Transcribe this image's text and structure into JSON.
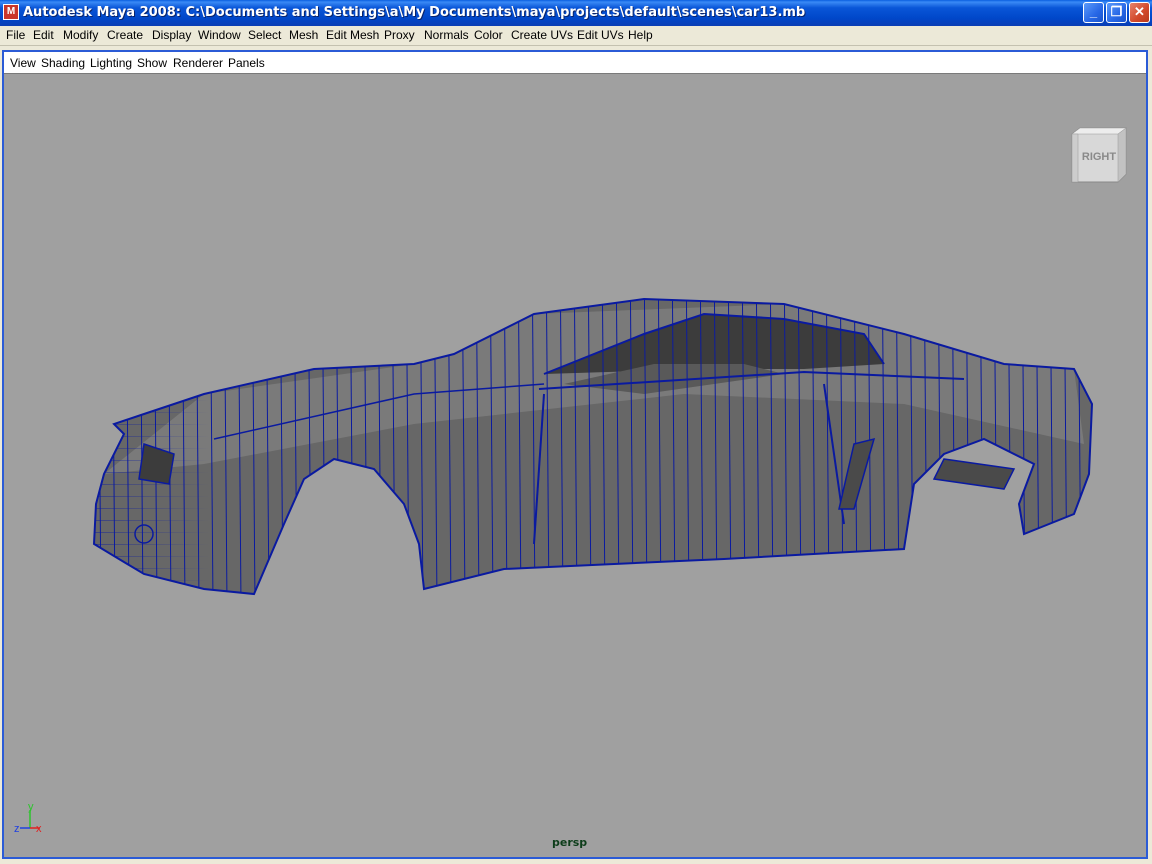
{
  "window": {
    "title": "Autodesk Maya 2008: C:\\Documents and Settings\\a\\My Documents\\maya\\projects\\default\\scenes\\car13.mb",
    "icon": "maya-app-icon",
    "controls": {
      "minimize": "_",
      "maximize": "❐",
      "close": "✕"
    }
  },
  "main_menu": [
    "File",
    "Edit",
    "Modify",
    "Create",
    "Display",
    "Window",
    "Select",
    "Mesh",
    "Edit Mesh",
    "Proxy",
    "Normals",
    "Color",
    "Create UVs",
    "Edit UVs",
    "Help"
  ],
  "panel_menu": [
    "View",
    "Shading",
    "Lighting",
    "Show",
    "Renderer",
    "Panels"
  ],
  "viewport": {
    "camera": "persp",
    "viewcube_face": "RIGHT",
    "axis": {
      "x": "x",
      "y": "y",
      "z": "z"
    },
    "background": "#a0a0a0",
    "wire_color": "#0a1aa0",
    "mesh_fill": "#6a6a6a"
  }
}
